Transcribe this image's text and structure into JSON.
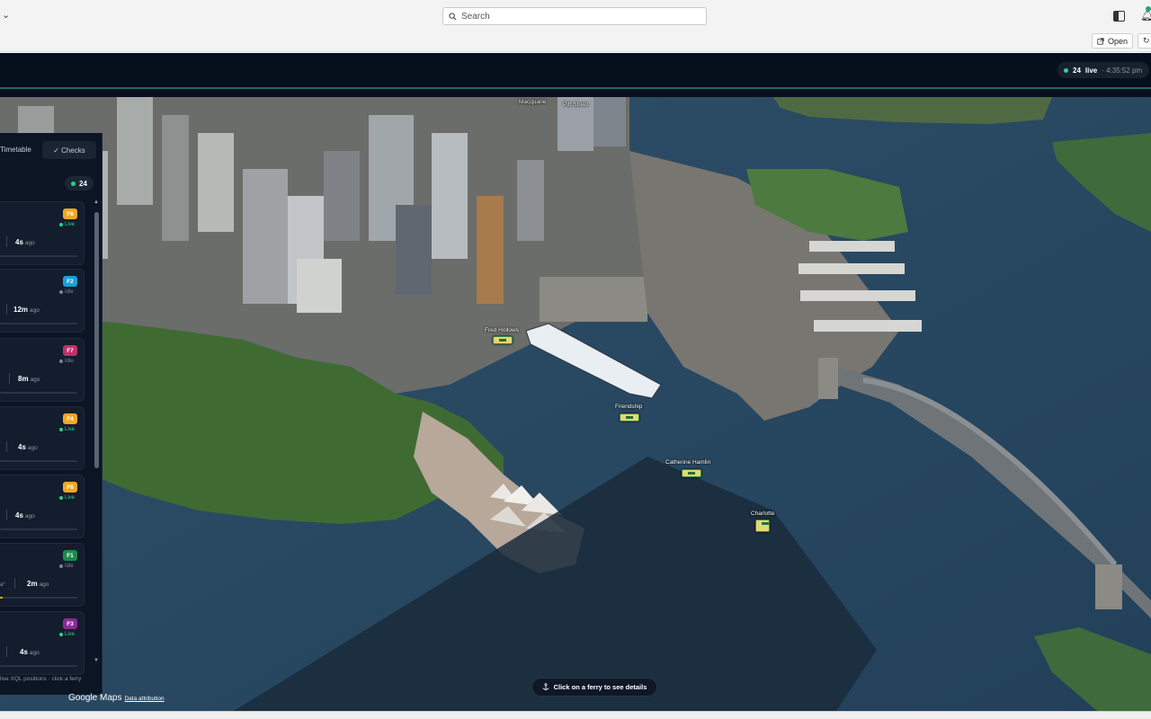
{
  "browser": {
    "search_placeholder": "Search",
    "open_label": "Open"
  },
  "header": {
    "live_count": "24",
    "live_label": "live",
    "time": "· 4:35:52 pm"
  },
  "sidebar": {
    "tab_timetable": "Timetable",
    "tab_checks": "✓ Checks",
    "count": "24",
    "footer": "live XQL positions · click a ferry",
    "cards": [
      {
        "route": "F6",
        "route_color": "#f5a623",
        "status": "Live",
        "ago_value": "4s",
        "ago_unit": "ago"
      },
      {
        "route": "F2",
        "route_color": "#1aa0d8",
        "status": "Idle",
        "ago_value": "12m",
        "ago_unit": "ago"
      },
      {
        "route": "F7",
        "route_color": "#c0306a",
        "status": "Idle",
        "ago_value": "8m",
        "ago_unit": "ago"
      },
      {
        "route": "F4",
        "route_color": "#f5a623",
        "status": "Live",
        "ago_value": "4s",
        "ago_unit": "ago"
      },
      {
        "route": "F6",
        "route_color": "#f5a623",
        "status": "Live",
        "ago_value": "4s",
        "ago_unit": "ago"
      },
      {
        "route": "F1",
        "route_color": "#1e8a4a",
        "status": "Idle",
        "ago_value": "2m",
        "ago_unit": "ago",
        "extra": "a°"
      },
      {
        "route": "F3",
        "route_color": "#8a2a9a",
        "status": "Live",
        "ago_value": "4s",
        "ago_unit": "ago"
      }
    ]
  },
  "map": {
    "ferries": [
      {
        "name": "Fred Hollows"
      },
      {
        "name": "Friendship"
      },
      {
        "name": "Catherine Hamlin"
      },
      {
        "name": "Charlotte"
      }
    ],
    "street_labels": [
      "Macquarie",
      "Pitt Street"
    ],
    "attribution_brand": "Google Maps",
    "attribution_link": "Data attribution",
    "hint": "Click on a ferry to see details"
  },
  "colors": {
    "water": "#2b4a63",
    "accent": "#1d6b5c",
    "live": "#2bd48a"
  }
}
